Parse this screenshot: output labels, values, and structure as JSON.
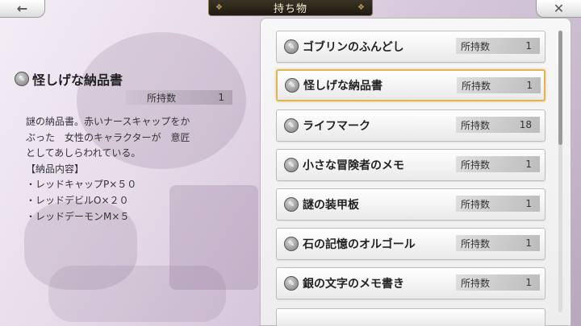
{
  "header": {
    "title": "持ち物",
    "back_label": "←",
    "close_label": "✕"
  },
  "detail": {
    "name": "怪しげな納品書",
    "count_label": "所持数",
    "count": "1",
    "description_lines": [
      "謎の納品書。赤いナースキャップをか",
      "ぶった　女性のキャラクターが　意匠",
      "としてあしらわれている。",
      "【納品内容】",
      "・レッドキャップP×５０",
      "・レッドデビルO×２０",
      "・レッドデーモンM×５"
    ]
  },
  "items": [
    {
      "name": "ゴブリンのふんどし",
      "count_label": "所持数",
      "count": "1",
      "selected": false
    },
    {
      "name": "怪しげな納品書",
      "count_label": "所持数",
      "count": "1",
      "selected": true
    },
    {
      "name": "ライフマーク",
      "count_label": "所持数",
      "count": "18",
      "selected": false
    },
    {
      "name": "小さな冒険者のメモ",
      "count_label": "所持数",
      "count": "1",
      "selected": false
    },
    {
      "name": "謎の装甲板",
      "count_label": "所持数",
      "count": "1",
      "selected": false
    },
    {
      "name": "石の記憶のオルゴール",
      "count_label": "所持数",
      "count": "1",
      "selected": false
    },
    {
      "name": "銀の文字のメモ書き",
      "count_label": "所持数",
      "count": "1",
      "selected": false
    }
  ],
  "icons": {
    "item": "item-pouch-icon",
    "back": "back-arrow-icon",
    "close": "close-icon"
  },
  "colors": {
    "selected_border": "#e0b451",
    "title_plate": "#2a2319",
    "title_text": "#f4ead0"
  },
  "scroll": {
    "position_fraction": 0.0,
    "visible_fraction": 0.4
  }
}
